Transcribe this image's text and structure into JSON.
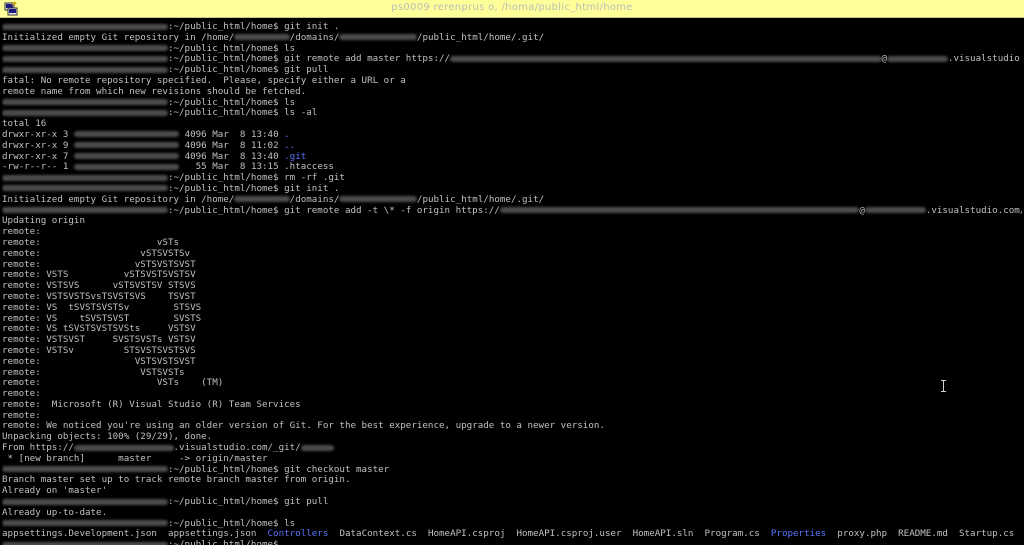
{
  "window": {
    "title_blurred": "ps0009 rerenprus o, /homa/public_html/home",
    "icon": "putty-terminal-icon"
  },
  "colors": {
    "background": "#000000",
    "text": "#c0c0c0",
    "dir": "#5c74ff",
    "titlebar": "#ffff9a"
  },
  "terminal": {
    "lines": [
      {
        "segments": [
          {
            "blur": "xxxxxxxxxxxxxxxxxxxxxxxxxxxxxx"
          },
          {
            "t": ":~/public_html/home$ git init ."
          }
        ]
      },
      {
        "segments": [
          {
            "t": "Initialized empty Git repository in /home/"
          },
          {
            "blur": "xxxxxxxxxx"
          },
          {
            "t": "/domains/"
          },
          {
            "blur": "xxxxxxxxxxxxxx"
          },
          {
            "t": "/public_html/home/.git/"
          }
        ]
      },
      {
        "segments": [
          {
            "blur": "xxxxxxxxxxxxxxxxxxxxxxxxxxxxxx"
          },
          {
            "t": ":~/public_html/home$ ls"
          }
        ]
      },
      {
        "segments": [
          {
            "blur": "xxxxxxxxxxxxxxxxxxxxxxxxxxxxxx"
          },
          {
            "t": ":~/public_html/home$ git remote add master https://"
          },
          {
            "blur": "xxxxxxxxxxxxxxxxxxxxxxxxxxxxxxxxxxxxxxxxxxxxxxxxxxxxxxxxxxxxxxxxxxxxxxxxxxxxxx"
          },
          {
            "t": "@"
          },
          {
            "blur": "xxxxxxxxxxx"
          },
          {
            "t": ".visualstudio.com/_git/"
          },
          {
            "blur": "xxxxxx"
          }
        ]
      },
      {
        "segments": [
          {
            "blur": "xxxxxxxxxxxxxxxxxxxxxxxxxxxxxx"
          },
          {
            "t": ":~/public_html/home$ git pull"
          }
        ]
      },
      {
        "segments": [
          {
            "t": "fatal: No remote repository specified.  Please, specify either a URL or a"
          }
        ]
      },
      {
        "segments": [
          {
            "t": "remote name from which new revisions should be fetched."
          }
        ]
      },
      {
        "segments": [
          {
            "blur": "xxxxxxxxxxxxxxxxxxxxxxxxxxxxxx"
          },
          {
            "t": ":~/public_html/home$ ls"
          }
        ]
      },
      {
        "segments": [
          {
            "blur": "xxxxxxxxxxxxxxxxxxxxxxxxxxxxxx"
          },
          {
            "t": ":~/public_html/home$ ls -al"
          }
        ]
      },
      {
        "segments": [
          {
            "t": "total 16"
          }
        ]
      },
      {
        "segments": [
          {
            "t": "drwxr-xr-x 3 "
          },
          {
            "blur": "xxxxxxxxxxxxxxxxxxx"
          },
          {
            "t": " 4096 Mar  8 13:40 "
          },
          {
            "t": ".",
            "c": "blue"
          }
        ]
      },
      {
        "segments": [
          {
            "t": "drwxr-xr-x 9 "
          },
          {
            "blur": "xxxxxxxxxxxxxxxxxxx"
          },
          {
            "t": " 4096 Mar  8 11:02 "
          },
          {
            "t": "..",
            "c": "blue"
          }
        ]
      },
      {
        "segments": [
          {
            "t": "drwxr-xr-x 7 "
          },
          {
            "blur": "xxxxxxxxxxxxxxxxxxx"
          },
          {
            "t": " 4096 Mar  8 13:40 "
          },
          {
            "t": ".git",
            "c": "blue"
          }
        ]
      },
      {
        "segments": [
          {
            "t": "-rw-r--r-- 1 "
          },
          {
            "blur": "xxxxxxxxxxxxxxxxxxx"
          },
          {
            "t": "   55 Mar  8 13:15 .htaccess"
          }
        ]
      },
      {
        "segments": [
          {
            "blur": "xxxxxxxxxxxxxxxxxxxxxxxxxxxxxx"
          },
          {
            "t": ":~/public_html/home$ rm -rf .git"
          }
        ]
      },
      {
        "segments": [
          {
            "blur": "xxxxxxxxxxxxxxxxxxxxxxxxxxxxxx"
          },
          {
            "t": ":~/public_html/home$ git init ."
          }
        ]
      },
      {
        "segments": [
          {
            "t": "Initialized empty Git repository in /home/"
          },
          {
            "blur": "xxxxxxxxxx"
          },
          {
            "t": "/domains/"
          },
          {
            "blur": "xxxxxxxxxxxxxx"
          },
          {
            "t": "/public_html/home/.git/"
          }
        ]
      },
      {
        "segments": [
          {
            "blur": "xxxxxxxxxxxxxxxxxxxxxxxxxxxxxx"
          },
          {
            "t": ":~/public_html/home$ git remote add -t \\* -f origin https://"
          },
          {
            "blur": "xxxxxxxxxxxxxxxxxxxxxxxxxxxxxxxxxxxxxxxxxxxxxxxxxxxxxxxxxxxxxxxxx"
          },
          {
            "t": "@"
          },
          {
            "blur": "xxxxxxxxxxx"
          },
          {
            "t": ".visualstudio.com/_git/"
          },
          {
            "blur": "xxxxxx"
          }
        ]
      },
      {
        "segments": [
          {
            "t": "Updating origin"
          }
        ]
      },
      {
        "segments": [
          {
            "t": "remote:"
          }
        ]
      },
      {
        "segments": [
          {
            "t": "remote:                     vSTs"
          }
        ]
      },
      {
        "segments": [
          {
            "t": "remote:                  vSTSVSTSv"
          }
        ]
      },
      {
        "segments": [
          {
            "t": "remote:                 vSTSVSTSVST"
          }
        ]
      },
      {
        "segments": [
          {
            "t": "remote: VSTS          vSTSVSTSVSTSV"
          }
        ]
      },
      {
        "segments": [
          {
            "t": "remote: VSTSVS      vSTSVSTSV STSVS"
          }
        ]
      },
      {
        "segments": [
          {
            "t": "remote: VSTSVSTSvsTSVSTSVS    TSVST"
          }
        ]
      },
      {
        "segments": [
          {
            "t": "remote: VS  tSVSTSVSTSv        STSVS"
          }
        ]
      },
      {
        "segments": [
          {
            "t": "remote: VS    tSVSTSVST        SVSTS"
          }
        ]
      },
      {
        "segments": [
          {
            "t": "remote: VS tSVSTSVSTSVSts     VSTSV"
          }
        ]
      },
      {
        "segments": [
          {
            "t": "remote: VSTSVST     SVSTSVSTs VSTSV"
          }
        ]
      },
      {
        "segments": [
          {
            "t": "remote: VSTSv         STSVSTSVSTSVS"
          }
        ]
      },
      {
        "segments": [
          {
            "t": "remote:                 VSTSVSTSVST"
          }
        ]
      },
      {
        "segments": [
          {
            "t": "remote:                  VSTSVSTs"
          }
        ]
      },
      {
        "segments": [
          {
            "t": "remote:                     VSTs    (TM)"
          }
        ]
      },
      {
        "segments": [
          {
            "t": "remote:"
          }
        ]
      },
      {
        "segments": [
          {
            "t": "remote:  Microsoft (R) Visual Studio (R) Team Services"
          }
        ]
      },
      {
        "segments": [
          {
            "t": "remote:"
          }
        ]
      },
      {
        "segments": [
          {
            "t": "remote: We noticed you're using an older version of Git. For the best experience, upgrade to a newer version."
          }
        ]
      },
      {
        "segments": [
          {
            "t": "Unpacking objects: 100% (29/29), done."
          }
        ]
      },
      {
        "segments": [
          {
            "t": "From https://"
          },
          {
            "blur": "xxxxxxxxxxxxxxxxxx"
          },
          {
            "t": ".visualstudio.com/_git/"
          },
          {
            "blur": "xxxxxx"
          }
        ]
      },
      {
        "segments": [
          {
            "t": " * [new branch]      master     -> origin/master"
          }
        ]
      },
      {
        "segments": [
          {
            "blur": "xxxxxxxxxxxxxxxxxxxxxxxxxxxxxx"
          },
          {
            "t": ":~/public_html/home$ git checkout master"
          }
        ]
      },
      {
        "segments": [
          {
            "t": "Branch master set up to track remote branch master from origin."
          }
        ]
      },
      {
        "segments": [
          {
            "t": "Already on 'master'"
          }
        ]
      },
      {
        "segments": [
          {
            "blur": "xxxxxxxxxxxxxxxxxxxxxxxxxxxxxx"
          },
          {
            "t": ":~/public_html/home$ git pull"
          }
        ]
      },
      {
        "segments": [
          {
            "t": "Already up-to-date."
          }
        ]
      },
      {
        "segments": [
          {
            "blur": "xxxxxxxxxxxxxxxxxxxxxxxxxxxxxx"
          },
          {
            "t": ":~/public_html/home$ ls"
          }
        ]
      },
      {
        "segments": [
          {
            "t": "appsettings.Development.json  appsettings.json  "
          },
          {
            "t": "Controllers",
            "c": "blue"
          },
          {
            "t": "  DataContext.cs  HomeAPI.csproj  HomeAPI.csproj.user  HomeAPI.sln  Program.cs  "
          },
          {
            "t": "Properties",
            "c": "blue"
          },
          {
            "t": "  proxy.php  README.md  Startup.cs"
          }
        ]
      },
      {
        "segments": [
          {
            "blur": "xxxxxxxxxxxxxxxxxxxxxxxxxxxxxx"
          },
          {
            "t": ":~/public_html/home$ "
          }
        ]
      }
    ]
  }
}
